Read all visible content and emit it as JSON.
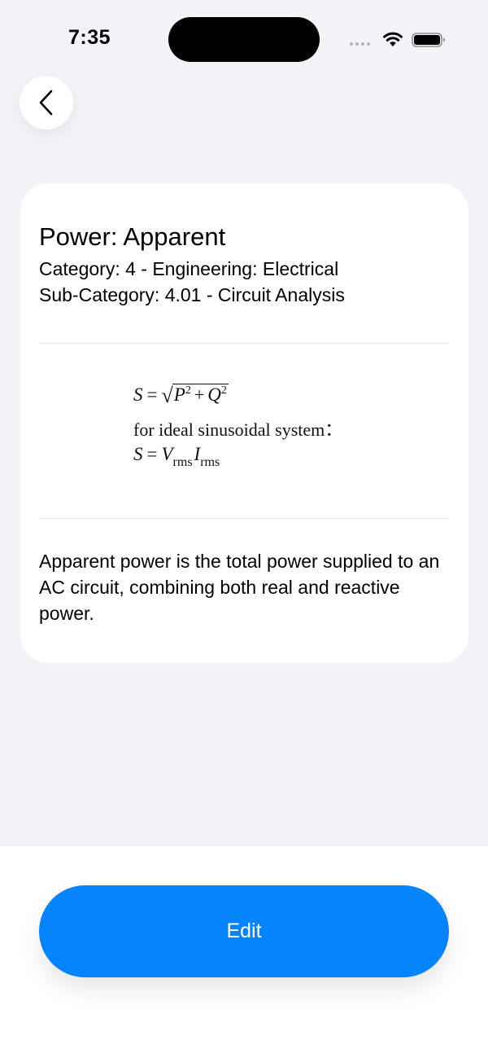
{
  "status_bar": {
    "time": "7:35"
  },
  "navigation": {
    "back_icon": "chevron-left-icon"
  },
  "card": {
    "title": "Power: Apparent",
    "category": "Category: 4 - Engineering: Electrical",
    "subcategory": "Sub-Category: 4.01 - Circuit Analysis",
    "formula": {
      "line1_lhs": "S",
      "line1_eq": "=",
      "line1_p": "P",
      "line1_p_exp": "2",
      "line1_plus": "+",
      "line1_q": "Q",
      "line1_q_exp": "2",
      "line2": "for ideal sinusoidal system：",
      "line3_lhs": "S",
      "line3_eq": "=",
      "line3_v": "V",
      "line3_v_sub": "rms",
      "line3_i": "I",
      "line3_i_sub": "rms"
    },
    "description": "Apparent power is the total power supplied to an AC circuit, combining both real and reactive power."
  },
  "footer": {
    "edit_label": "Edit"
  },
  "colors": {
    "background": "#f2f2f7",
    "accent": "#0584fe",
    "card": "#ffffff"
  }
}
